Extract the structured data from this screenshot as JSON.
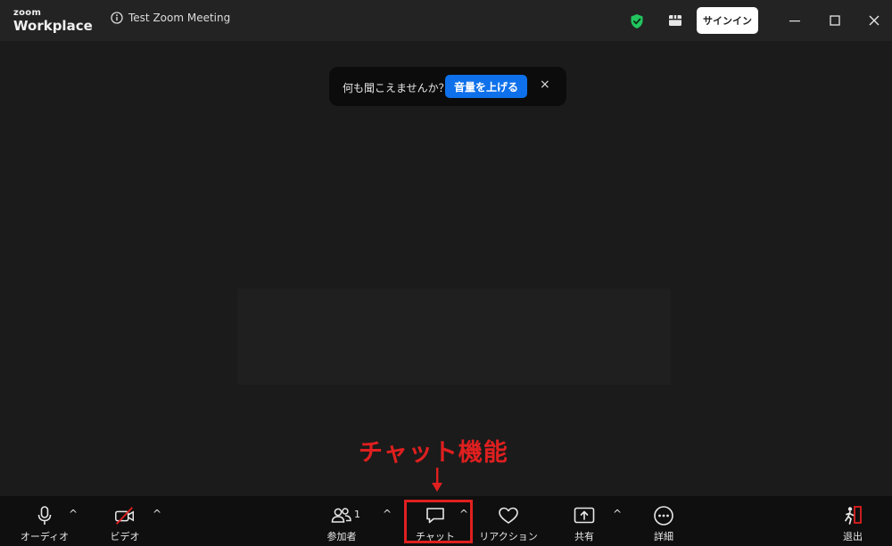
{
  "titlebar": {
    "brand_top": "zoom",
    "brand_bottom": "Workplace",
    "meeting_title": "Test Zoom Meeting",
    "signin_label": "サインイン",
    "shield_color": "#22c55e"
  },
  "banner": {
    "text": "何も聞こえませんか？",
    "button_label": "音量を上げる",
    "close_glyph": "×"
  },
  "annotation": {
    "label": "チャット機能",
    "color": "#e01f1f"
  },
  "toolbar": {
    "audio_label": "オーディオ",
    "video_label": "ビデオ",
    "participants_label": "参加者",
    "participants_count": "1",
    "chat_label": "チャット",
    "reactions_label": "リアクション",
    "share_label": "共有",
    "more_label": "詳細",
    "leave_label": "退出",
    "caret_glyph": "^"
  }
}
